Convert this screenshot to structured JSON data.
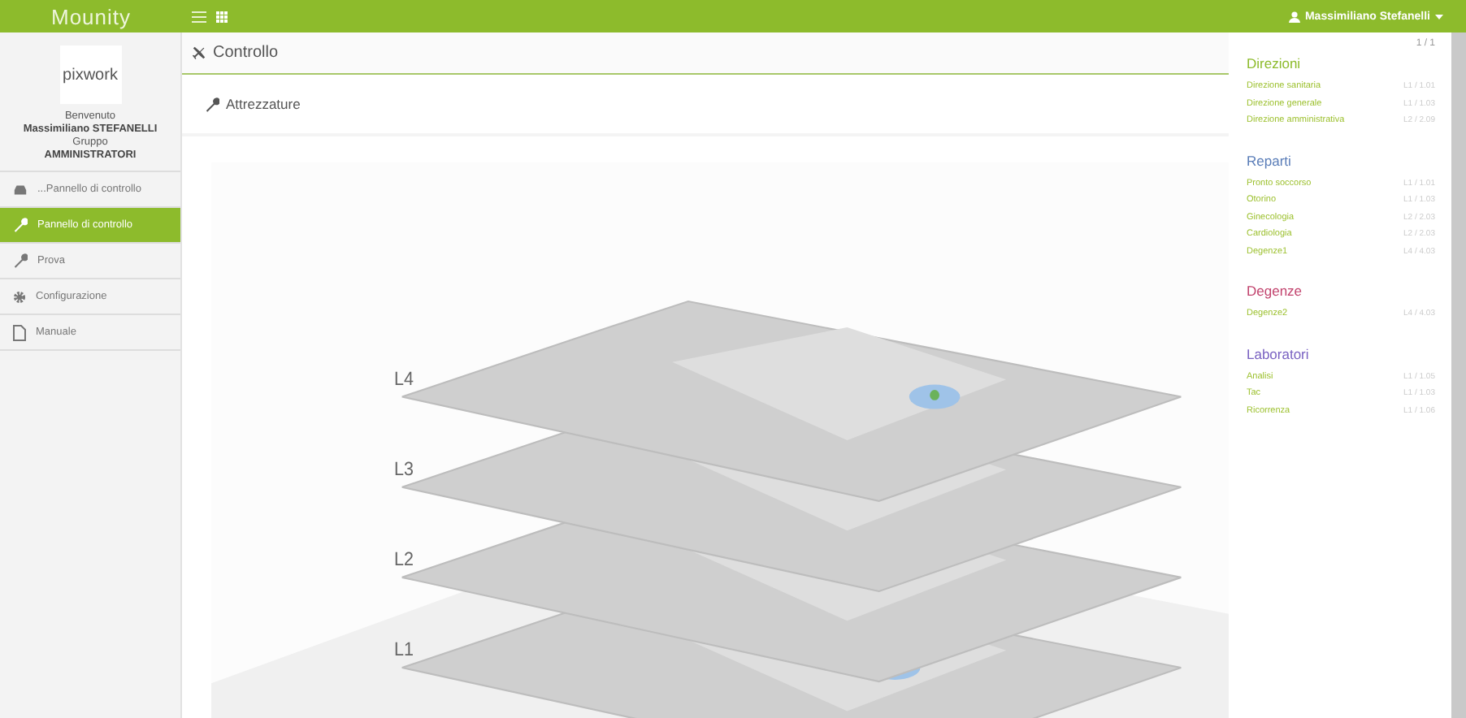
{
  "topbar": {
    "logo": "Mounity",
    "user": "Massimiliano Stefanelli"
  },
  "sidebar": {
    "company_logo": "pixwork",
    "welcome_label": "Benvenuto",
    "user_name": "Massimiliano STEFANELLI",
    "group_label": "Gruppo",
    "group_name": "AMMINISTRATORI",
    "items": [
      {
        "label": "...Pannello di controllo",
        "selected": false
      },
      {
        "label": "Pannello di controllo",
        "selected": true
      },
      {
        "label": "Prova",
        "selected": false
      },
      {
        "label": "Configurazione",
        "selected": false
      },
      {
        "label": "Manuale",
        "selected": false
      }
    ]
  },
  "page": {
    "title": "Controllo",
    "subtitle": "Attrezzature",
    "map": {
      "floor_labels": [
        "L4",
        "L3",
        "L2",
        "L1"
      ]
    }
  },
  "panel": {
    "pager": "1 / 1",
    "groups": [
      {
        "title": "Direzioni",
        "color": "#8dbb2c",
        "items": [
          {
            "name": "Direzione sanitaria",
            "location": "L1 / 1.01"
          },
          {
            "name": "Direzione generale",
            "location": "L1 / 1.03"
          },
          {
            "name": "Direzione amministrativa",
            "location": "L2 / 2.09"
          }
        ]
      },
      {
        "title": "Reparti",
        "color": "#5a7db8",
        "items": [
          {
            "name": "Pronto soccorso",
            "location": "L1 / 1.01"
          },
          {
            "name": "Otorino",
            "location": "L1 / 1.03"
          },
          {
            "name": "Ginecologia",
            "location": "L2 / 2.03"
          },
          {
            "name": "Cardiologia",
            "location": "L2 / 2.03"
          },
          {
            "name": "Degenze1",
            "location": "L4 / 4.03"
          }
        ]
      },
      {
        "title": "Degenze",
        "color": "#c2446e",
        "items": [
          {
            "name": "Degenze2",
            "location": "L4 / 4.03"
          }
        ]
      },
      {
        "title": "Laboratori",
        "color": "#7a62c2",
        "items": [
          {
            "name": "Analisi",
            "location": "L1 / 1.05"
          },
          {
            "name": "Tac",
            "location": "L1 / 1.03"
          },
          {
            "name": "Ricorrenza",
            "location": "L1 / 1.06"
          }
        ]
      }
    ]
  }
}
